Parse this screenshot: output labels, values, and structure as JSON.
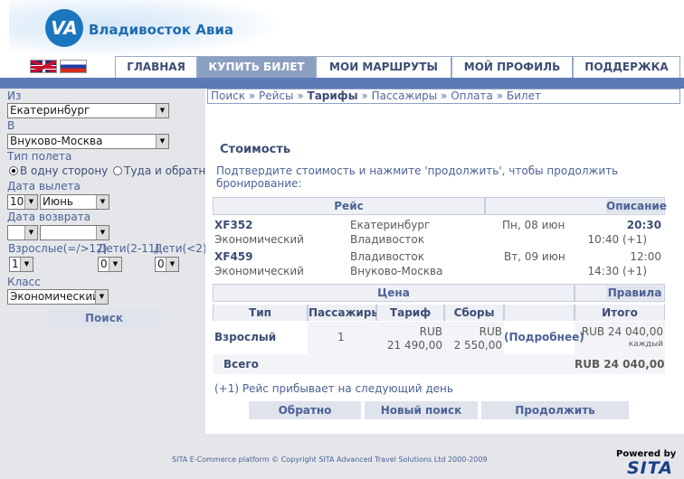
{
  "brand": {
    "logo_mark": "VA",
    "name": "Владивосток Авиа"
  },
  "nav": {
    "tabs": [
      "ГЛАВНАЯ",
      "КУПИТЬ БИЛЕТ",
      "МОИ МАРШРУТЫ",
      "МОЙ ПРОФИЛЬ",
      "ПОДДЕРЖКА"
    ],
    "active": "КУПИТЬ БИЛЕТ"
  },
  "languages": [
    "English",
    "Русский"
  ],
  "search": {
    "from_label": "Из",
    "from_value": "Екатеринбург",
    "to_label": "В",
    "to_value": "Внуково-Москва",
    "trip_type_label": "Тип полета",
    "one_way": "В одну сторону",
    "round_trip": "Туда и обратно",
    "depart_label": "Дата вылета",
    "depart_day": "10",
    "depart_month": "Июнь",
    "return_label": "Дата возврата",
    "return_day": "",
    "return_month": "",
    "adults_label": "Взрослые(=/>12)",
    "adults_value": "1",
    "children_label": "Дети(2-11)",
    "children_value": "0",
    "infants_label": "Дети(<2)",
    "infants_value": "0",
    "class_label": "Класс",
    "class_value": "Экономический",
    "submit": "Поиск"
  },
  "breadcrumb": {
    "items": [
      "Поиск",
      "Рейсы",
      "Тарифы",
      "Пассажиры",
      "Оплата",
      "Билет"
    ],
    "sep": "»",
    "current": "Тарифы"
  },
  "page": {
    "title": "Стоимость",
    "subtitle": "Подтвердите стоимость и нажмите 'продолжить', чтобы продолжить бронирование:"
  },
  "flights": {
    "header": "Рейс",
    "desc_button": "Описание",
    "rows": [
      {
        "code": "XF352",
        "class": "Экономический",
        "from": "Екатеринбург",
        "to": "Владивосток",
        "date": "Пн, 08 июн",
        "dep": "20:30",
        "arr": "10:40 (+1)"
      },
      {
        "code": "XF459",
        "class": "Экономический",
        "from": "Владивосток",
        "to": "Внуково-Москва",
        "date": "Вт, 09 июн",
        "dep": "12:00",
        "arr": "14:30 (+1)"
      }
    ]
  },
  "price": {
    "header": "Цена",
    "rules_button": "Правила",
    "columns": [
      "Тип",
      "Пассажиры",
      "Тариф",
      "Сборы",
      "",
      "Итого"
    ],
    "row": {
      "type": "Взрослый",
      "pax": "1",
      "fare_cur": "RUB",
      "fare": "21 490,00",
      "tax_cur": "RUB",
      "tax": "2 550,00",
      "details": "(Подробнее)",
      "total": "RUB 24 040,00",
      "each": "каждый"
    },
    "total_label": "Всего",
    "grand_total": "RUB 24 040,00"
  },
  "note": "(+1) Рейс прибывает на следующий день",
  "buttons": {
    "back": "Обратно",
    "new_search": "Новый поиск",
    "continue": "Продолжить"
  },
  "footer": {
    "copyright": "SITA E-Commerce platform © Copyright SITA Advanced Travel Solutions Ltd 2000-2009",
    "powered": "Powered by",
    "sita": "SITA"
  }
}
